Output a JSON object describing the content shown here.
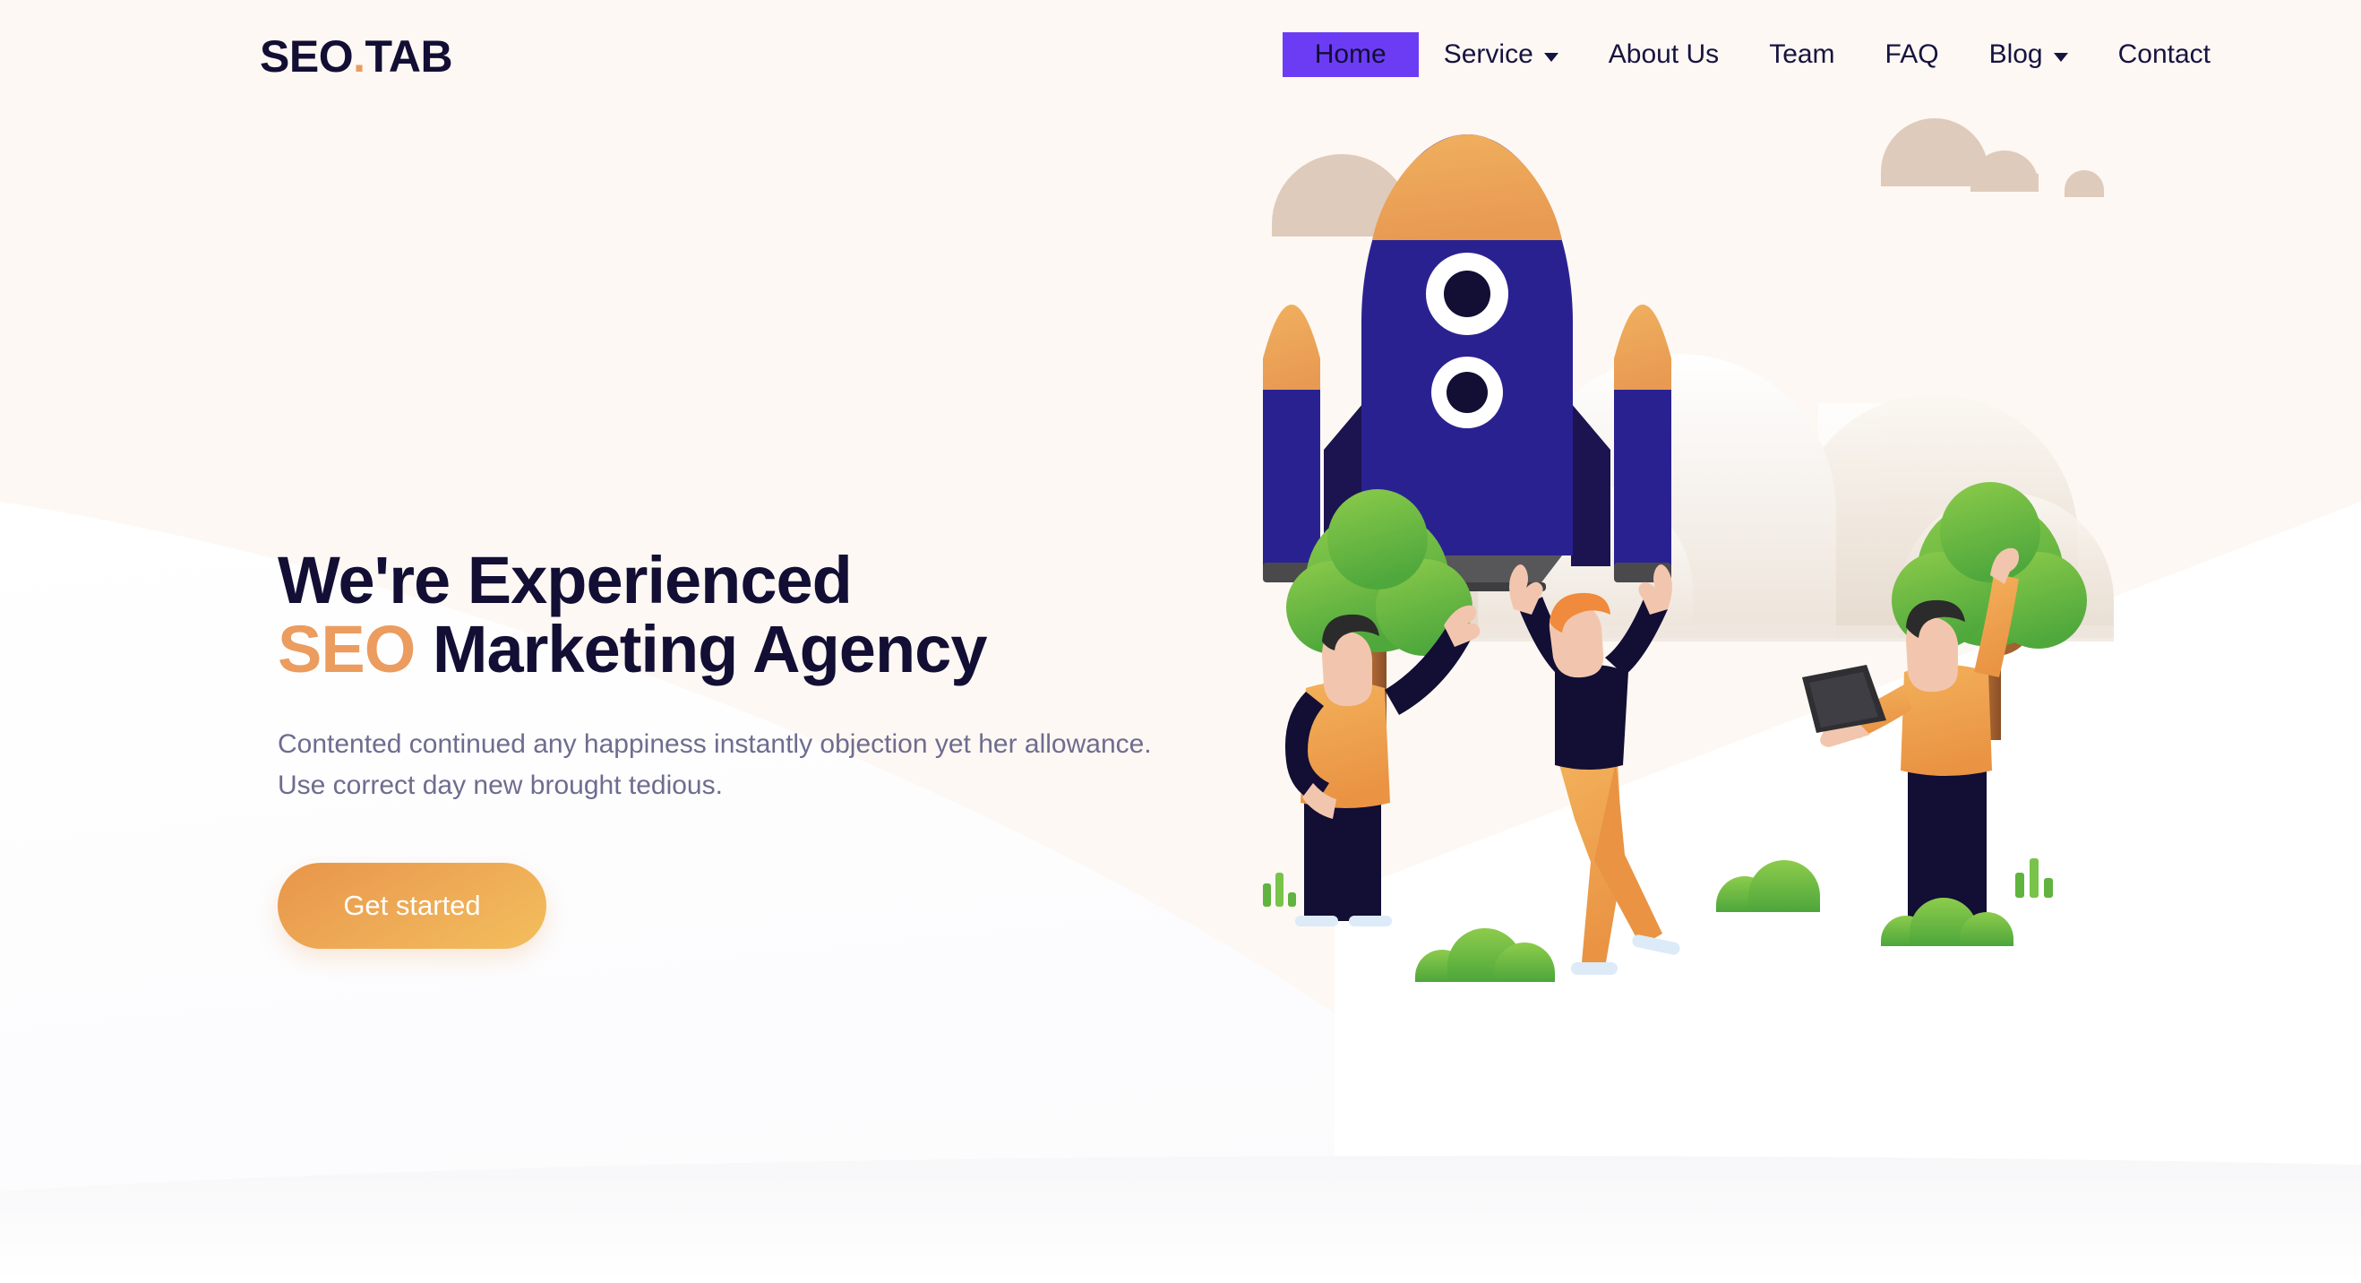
{
  "page": {
    "background_color": "#FDF8F3",
    "text_color": "#120E34",
    "accent_orange": "#EB9C5E",
    "accent_purple": "#6C3CF4",
    "muted_text": "#6E6C8F"
  },
  "header": {
    "logo": {
      "main": "SEO",
      "dot": ".",
      "tail": "TAB",
      "full": "SEO.TAB"
    },
    "nav": [
      {
        "label": "Home",
        "active": true,
        "has_dropdown": false
      },
      {
        "label": "Service",
        "active": false,
        "has_dropdown": true
      },
      {
        "label": "About Us",
        "active": false,
        "has_dropdown": false
      },
      {
        "label": "Team",
        "active": false,
        "has_dropdown": false
      },
      {
        "label": "FAQ",
        "active": false,
        "has_dropdown": false
      },
      {
        "label": "Blog",
        "active": false,
        "has_dropdown": true
      },
      {
        "label": "Contact",
        "active": false,
        "has_dropdown": false
      }
    ]
  },
  "hero": {
    "headline_line1": "We're Experienced",
    "headline_accent": "SEO",
    "headline_line2_rest": " Marketing Agency",
    "subcopy_line1": "Contented continued any happiness instantly objection yet her allowance.",
    "subcopy_line2": "Use correct day new brought tedious.",
    "cta_label": "Get started"
  },
  "illustration": {
    "description": "rocket launching with three cheering people, trees, bushes and clouds",
    "colors": {
      "rocket_body": "#2A2191",
      "rocket_fin": "#1B1450",
      "rocket_nose": "#EFA95E",
      "rocket_nozzle": "#4A4A4C",
      "window_ring": "#FFFFFF",
      "window_center": "#120E34",
      "cloud_tan": "#DFCBBB",
      "smoke": "#EFE7DF",
      "tree_green": "#6CBE45",
      "trunk_brown": "#A2622F",
      "skin": "#F2C6AE",
      "navy_clothes": "#120E34",
      "orange_clothes": "#EFA44F",
      "hair_dark": "#2B2B2B",
      "hair_orange": "#F08A3C",
      "shoe_blue": "#DDEAF7"
    }
  }
}
